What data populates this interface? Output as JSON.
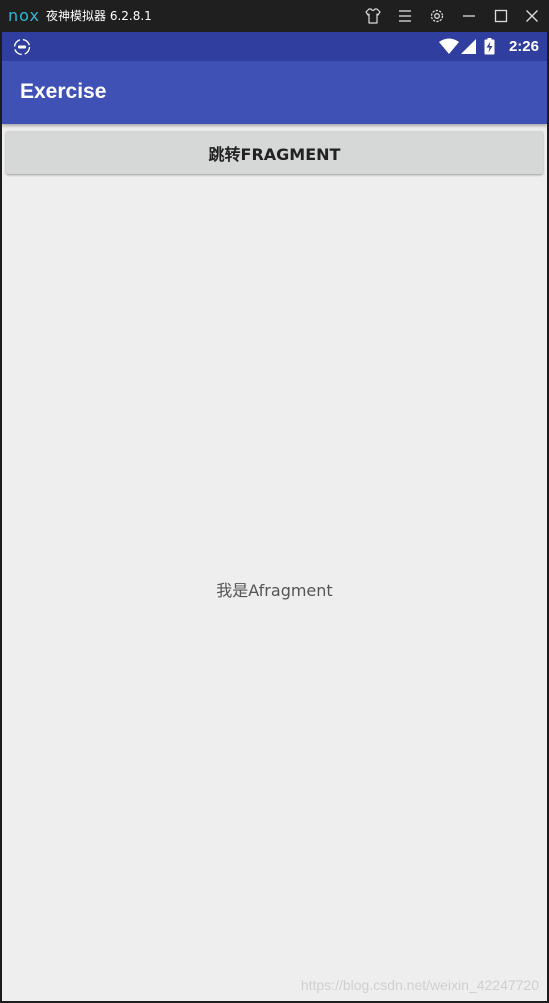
{
  "emulator": {
    "logo": "nox",
    "title": "夜神模拟器 6.2.8.1",
    "controls": [
      "shirt-icon",
      "menu-icon",
      "gear-icon",
      "minimize-icon",
      "maximize-icon",
      "close-icon"
    ]
  },
  "status_bar": {
    "time": "2:26",
    "icons": [
      "nox-icon",
      "wifi-icon",
      "signal-icon",
      "battery-charging-icon"
    ]
  },
  "app_bar": {
    "title": "Exercise"
  },
  "main": {
    "jump_button_label": "跳转FRAGMENT",
    "fragment_text": "我是Afragment"
  },
  "watermark": "https://blog.csdn.net/weixin_42247720",
  "colors": {
    "status_bar": "#303f9f",
    "app_bar": "#3f51b5",
    "background": "#eeeeee",
    "button": "#d6d7d7",
    "emulator_frame": "#1f1f1f",
    "nox_logo": "#2fb7d4"
  }
}
